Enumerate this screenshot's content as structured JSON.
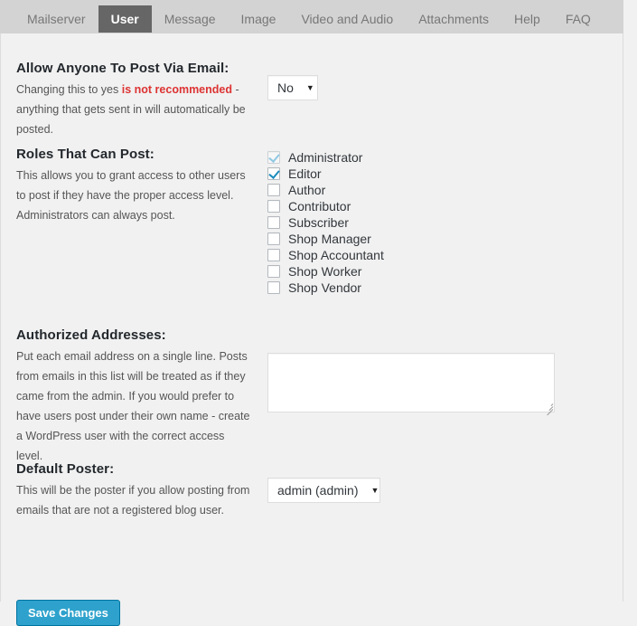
{
  "tabs": [
    {
      "label": "Mailserver",
      "active": false
    },
    {
      "label": "User",
      "active": true
    },
    {
      "label": "Message",
      "active": false
    },
    {
      "label": "Image",
      "active": false
    },
    {
      "label": "Video and Audio",
      "active": false
    },
    {
      "label": "Attachments",
      "active": false
    },
    {
      "label": "Help",
      "active": false
    },
    {
      "label": "FAQ",
      "active": false
    }
  ],
  "sections": {
    "allow_anyone": {
      "heading": "Allow Anyone To Post Via Email:",
      "desc_before": "Changing this to yes ",
      "desc_warn": "is not recommended",
      "desc_after": " - anything that gets sent in will automatically be posted.",
      "select_value": "No"
    },
    "roles": {
      "heading": "Roles That Can Post:",
      "desc": "This allows you to grant access to other users to post if they have the proper access level. Administrators can always post.",
      "items": [
        {
          "label": "Administrator",
          "checked": true,
          "disabled": true
        },
        {
          "label": "Editor",
          "checked": true,
          "disabled": false
        },
        {
          "label": "Author",
          "checked": false,
          "disabled": false
        },
        {
          "label": "Contributor",
          "checked": false,
          "disabled": false
        },
        {
          "label": "Subscriber",
          "checked": false,
          "disabled": false
        },
        {
          "label": "Shop Manager",
          "checked": false,
          "disabled": false
        },
        {
          "label": "Shop Accountant",
          "checked": false,
          "disabled": false
        },
        {
          "label": "Shop Worker",
          "checked": false,
          "disabled": false
        },
        {
          "label": "Shop Vendor",
          "checked": false,
          "disabled": false
        }
      ]
    },
    "authorized_addresses": {
      "heading": "Authorized Addresses:",
      "desc": "Put each email address on a single line. Posts from emails in this list will be treated as if they came from the admin. If you would prefer to have users post under their own name - create a WordPress user with the correct access level.",
      "value": "",
      "placeholder": ""
    },
    "default_poster": {
      "heading": "Default Poster:",
      "desc": "This will be the poster if you allow posting from emails that are not a registered blog user.",
      "select_value": "admin (admin)"
    }
  },
  "footer": {
    "save_label": "Save Changes"
  },
  "icons": {
    "caret": "▼"
  },
  "colors": {
    "accent": "#2ea2cc",
    "warning": "#dd3333",
    "active_tab_bg": "#666666",
    "tabbar_bg": "#d3d3d3",
    "page_bg": "#f1f1f1",
    "checkbox_check": "#1e8cbe"
  }
}
